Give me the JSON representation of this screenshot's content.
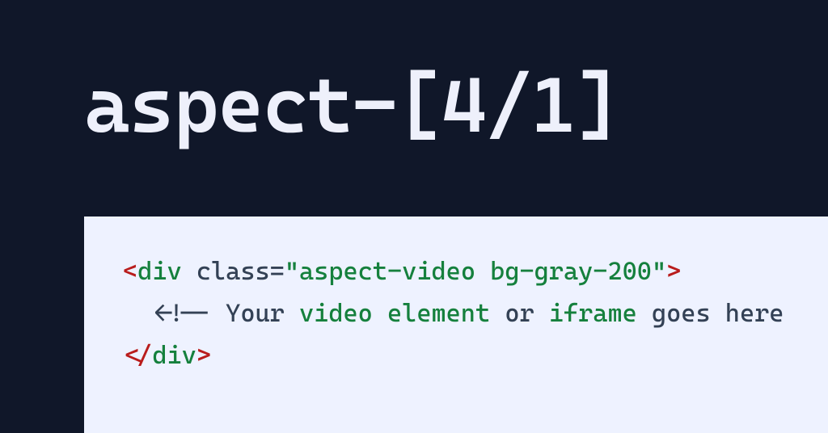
{
  "heading": "aspect-[4/1]",
  "code": {
    "line1": {
      "open_angle": "<",
      "tag": "div",
      "space1": " ",
      "attr_name": "class",
      "eq": "=",
      "q1": "\"",
      "attr_value": "aspect-video bg-gray-200",
      "q2": "\"",
      "close_angle": ">"
    },
    "line2": {
      "indent": "  ",
      "cmt_open": "<!-- ",
      "w1": "Your",
      "sp1": " ",
      "w2": "video",
      "sp2": " ",
      "w3": "element",
      "sp3": " ",
      "w4": "or",
      "sp4": " ",
      "w5": "iframe",
      "sp5": " ",
      "rest": "goes here"
    },
    "line3": {
      "open_angle": "</",
      "tag": "div",
      "close_angle": ">"
    }
  }
}
